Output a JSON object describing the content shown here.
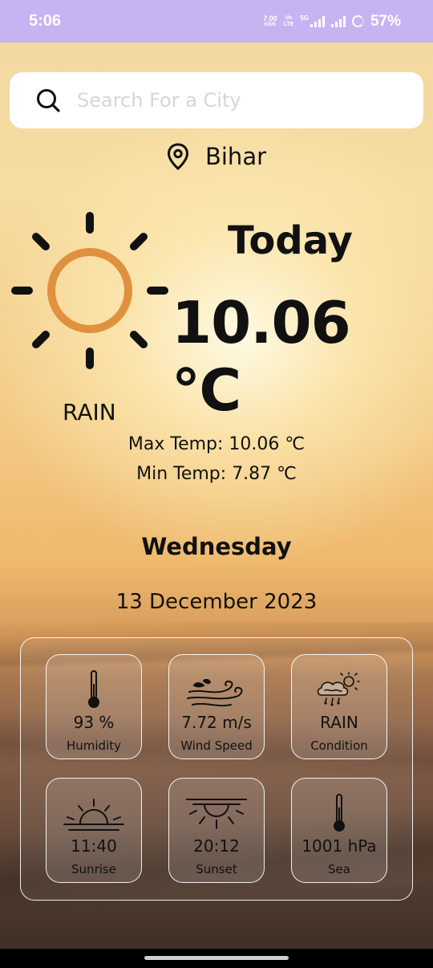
{
  "status_bar": {
    "time": "5:06",
    "net_speed_value": "7.00",
    "net_speed_unit": "KB/S",
    "volte": "Vo\nLTE",
    "network": "5G",
    "battery": "57%"
  },
  "search": {
    "placeholder": "Search For a City",
    "value": ""
  },
  "location": {
    "name": "Bihar"
  },
  "weather": {
    "today_label": "Today",
    "temperature": "10.06 ℃",
    "condition": "RAIN",
    "max_label": "Max Temp:",
    "max_value": "10.06 ℃",
    "min_label": "Min Temp:",
    "min_value": "7.87 ℃",
    "day": "Wednesday",
    "date": "13 December 2023"
  },
  "details": [
    {
      "icon": "thermometer-icon",
      "value": "93 %",
      "caption": "Humidity"
    },
    {
      "icon": "wind-icon",
      "value": "7.72 m/s",
      "caption": "Wind Speed"
    },
    {
      "icon": "cloud-rain-sun-icon",
      "value": "RAIN",
      "caption": "Condition"
    },
    {
      "icon": "sunrise-icon",
      "value": "11:40",
      "caption": "Sunrise"
    },
    {
      "icon": "sunset-icon",
      "value": "20:12",
      "caption": "Sunset"
    },
    {
      "icon": "thermometer-icon",
      "value": "1001 hPa",
      "caption": "Sea"
    }
  ],
  "colors": {
    "status_bar": "#c7b3f2",
    "sun_ring": "#e0913f",
    "card_border": "#ffffff"
  }
}
